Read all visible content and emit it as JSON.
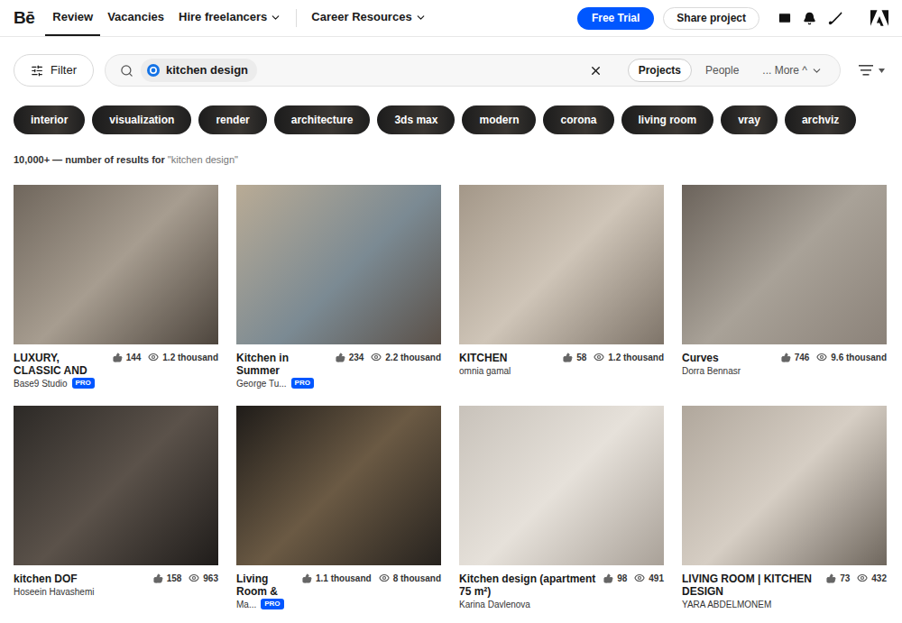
{
  "header": {
    "logo": "Bē",
    "nav": [
      {
        "label": "Review",
        "selected": true,
        "dropdown": false
      },
      {
        "label": "Vacancies",
        "selected": false,
        "dropdown": false
      },
      {
        "label": "Hire freelancers",
        "selected": false,
        "dropdown": true
      },
      {
        "label": "Career Resources",
        "selected": false,
        "dropdown": true
      }
    ],
    "free_trial": "Free Trial",
    "share": "Share project"
  },
  "search": {
    "filter": "Filter",
    "query": "kitchen design",
    "scopes": [
      {
        "label": "Projects",
        "selected": true
      },
      {
        "label": "People",
        "selected": false
      },
      {
        "label": "... More ^",
        "selected": false
      }
    ]
  },
  "tags": [
    {
      "label": "interior"
    },
    {
      "label": "visualization"
    },
    {
      "label": "render"
    },
    {
      "label": "architecture"
    },
    {
      "label": "3ds max"
    },
    {
      "label": "modern"
    },
    {
      "label": "corona"
    },
    {
      "label": "living room"
    },
    {
      "label": "vray"
    },
    {
      "label": "archviz"
    }
  ],
  "results": {
    "count": "10,000+ — number of results for",
    "query": "\"kitchen design\""
  },
  "projects": [
    {
      "title": "LUXURY, CLASSIC AND",
      "owner": "Base9 Studio",
      "pro": true,
      "likes": "144",
      "views": "1.2 thousand"
    },
    {
      "title": "Kitchen in Summer",
      "owner": "George Tu...",
      "pro": true,
      "likes": "234",
      "views": "2.2 thousand"
    },
    {
      "title": "KITCHEN",
      "owner": "omnia gamal",
      "pro": false,
      "likes": "58",
      "views": "1.2 thousand"
    },
    {
      "title": "Curves",
      "owner": "Dorra Bennasr",
      "pro": false,
      "likes": "746",
      "views": "9.6 thousand"
    },
    {
      "title": "kitchen DOF",
      "owner": "Hoseein Havashemi",
      "pro": false,
      "likes": "158",
      "views": "963"
    },
    {
      "title": "Living Room &",
      "owner": "Ma...",
      "pro": true,
      "likes": "1.1 thousand",
      "views": "8 thousand"
    },
    {
      "title": "Kitchen design (apartment 75 m²)",
      "owner": "Karina Davlenova",
      "pro": false,
      "likes": "98",
      "views": "491"
    },
    {
      "title": "LIVING ROOM | KITCHEN DESIGN",
      "owner": "YARA ABDELMONEM",
      "pro": false,
      "likes": "73",
      "views": "432"
    }
  ],
  "pro_badge": "PRO"
}
